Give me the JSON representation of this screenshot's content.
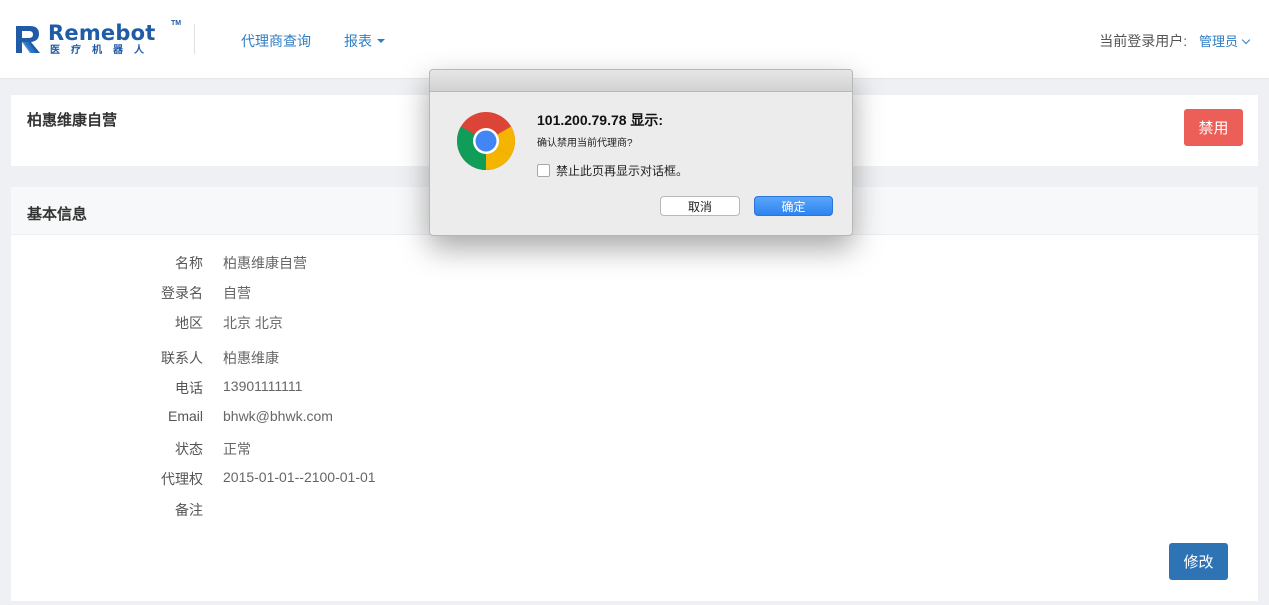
{
  "brand": {
    "name": "Remebot",
    "trademark": "TM",
    "subtitle": "医疗机器人",
    "color": "#1f5ba6"
  },
  "nav": {
    "items": [
      {
        "label": "代理商查询"
      },
      {
        "label": "报表",
        "icon": "caret-down-icon"
      }
    ]
  },
  "user": {
    "label": "当前登录用户:",
    "name": "管理员",
    "icon": "chevron-down-icon"
  },
  "agent": {
    "title": "柏惠维康自营",
    "disable_button": "禁用"
  },
  "info_section": {
    "title": "基本信息",
    "fields": [
      {
        "label": "名称",
        "value": "柏惠维康自营"
      },
      {
        "label": "登录名",
        "value": "自营"
      },
      {
        "label": "地区",
        "value": "北京 北京"
      },
      {
        "label": "联系人",
        "value": "柏惠维康"
      },
      {
        "label": "电话",
        "value": "13901111111"
      },
      {
        "label": "Email",
        "value": "bhwk@bhwk.com"
      },
      {
        "label": "状态",
        "value": "正常"
      },
      {
        "label": "代理权",
        "value": "2015-01-01--2100-01-01"
      },
      {
        "label": "备注",
        "value": ""
      }
    ],
    "edit_button": "修改"
  },
  "dialog": {
    "title": "101.200.79.78 显示:",
    "message": "确认禁用当前代理商?",
    "checkbox_label": "禁止此页再显示对话框。",
    "checkbox_checked": false,
    "cancel_label": "取消",
    "ok_label": "确定",
    "icon": "chrome-icon"
  },
  "colors": {
    "accent": "#2f7ec4",
    "danger": "#ec5f58",
    "primary": "#2e74b5",
    "dialog_ok": "#2d83f0"
  }
}
